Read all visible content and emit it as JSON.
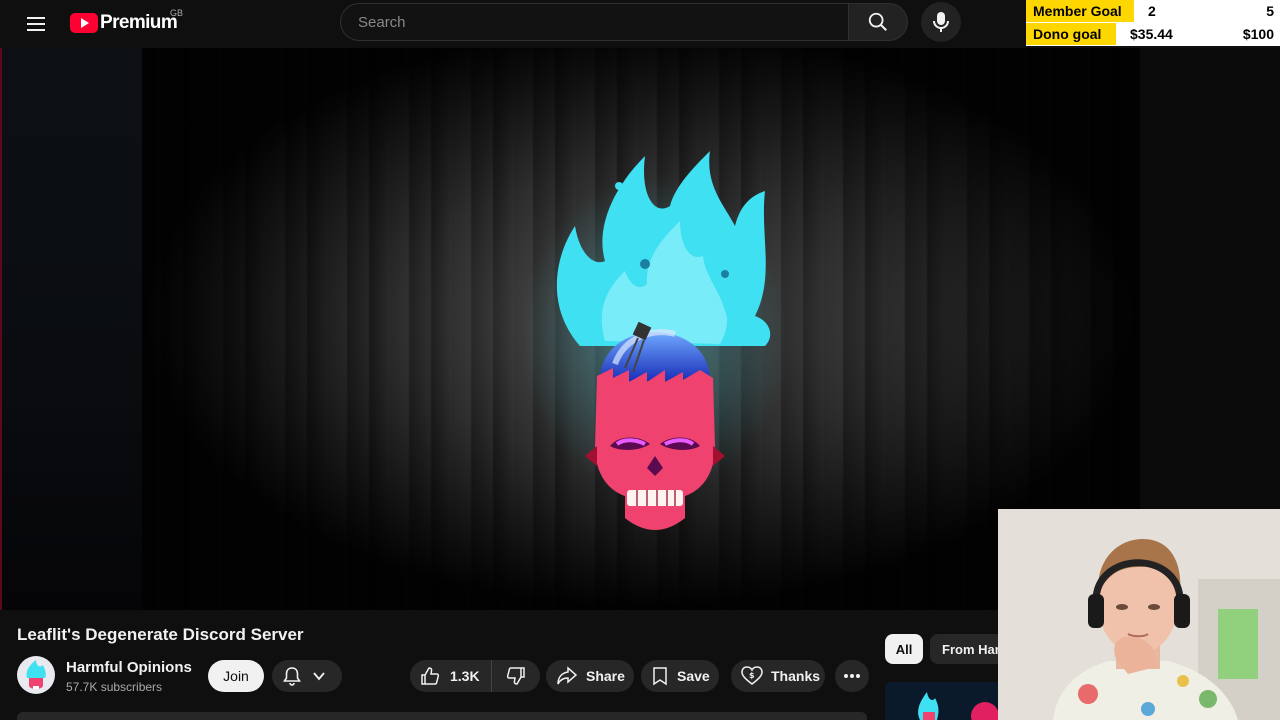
{
  "header": {
    "logo_text": "Premium",
    "country_code": "GB",
    "search_placeholder": "Search"
  },
  "goals": {
    "member": {
      "label": "Member Goal",
      "current": "2",
      "target": "5"
    },
    "dono": {
      "label": "Dono goal",
      "current": "$35.44",
      "target": "$100"
    }
  },
  "video": {
    "title": "Leaflit's Degenerate Discord Server"
  },
  "channel": {
    "name": "Harmful Opinions",
    "subscribers": "57.7K subscribers"
  },
  "actions": {
    "join_label": "Join",
    "like_count": "1.3K",
    "share_label": "Share",
    "save_label": "Save",
    "thanks_label": "Thanks"
  },
  "chips": {
    "all_label": "All",
    "from_label": "From Har"
  },
  "colors": {
    "brand_red": "#ff0033",
    "goal_yellow": "#ffd700",
    "background": "#0f0f0f",
    "pill_bg": "#272727",
    "skull_pink": "#f0426e",
    "flame_cyan": "#3ee0f2"
  }
}
